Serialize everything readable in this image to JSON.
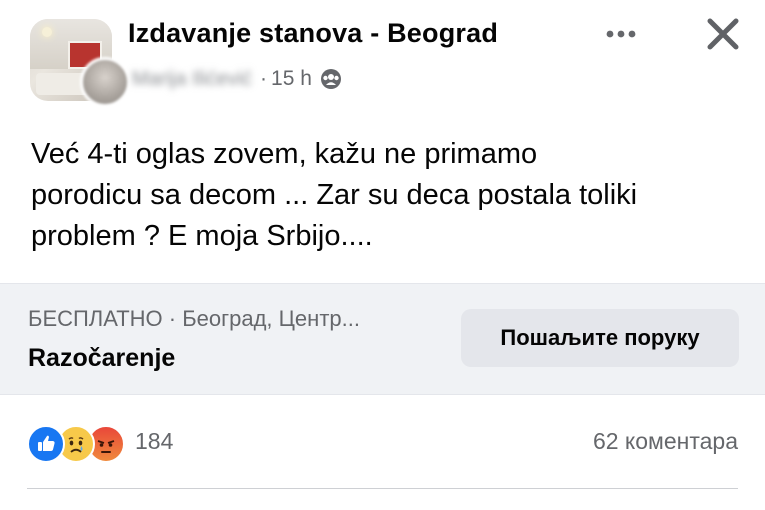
{
  "header": {
    "group_name": "Izdavanje stanova - Beograd",
    "author_name": "Marija Ilićević",
    "separator": "·",
    "time": "15 h",
    "audience_icon": "group-icon",
    "more_icon": "more-icon",
    "close_icon": "close-icon"
  },
  "post": {
    "lines": [
      "Već 4-ti oglas zovem, kažu ne primamo",
      "porodicu sa decom ... Zar su deca postala toliki",
      "problem ? E moja Srbijo...."
    ]
  },
  "listing": {
    "subtitle": "БЕСПЛАТНО · Београд, Центр...",
    "title": "Razočarenje",
    "button_label": "Пошаљите поруку"
  },
  "reactions": {
    "icons": [
      "like-icon",
      "sad-icon",
      "angry-icon"
    ],
    "count": "184",
    "comments": "62 коментара"
  },
  "colors": {
    "text_primary": "#050505",
    "text_secondary": "#65676b",
    "listing_background": "#f0f2f5",
    "button_background": "#e4e6eb",
    "like_blue": "#1877f2"
  }
}
